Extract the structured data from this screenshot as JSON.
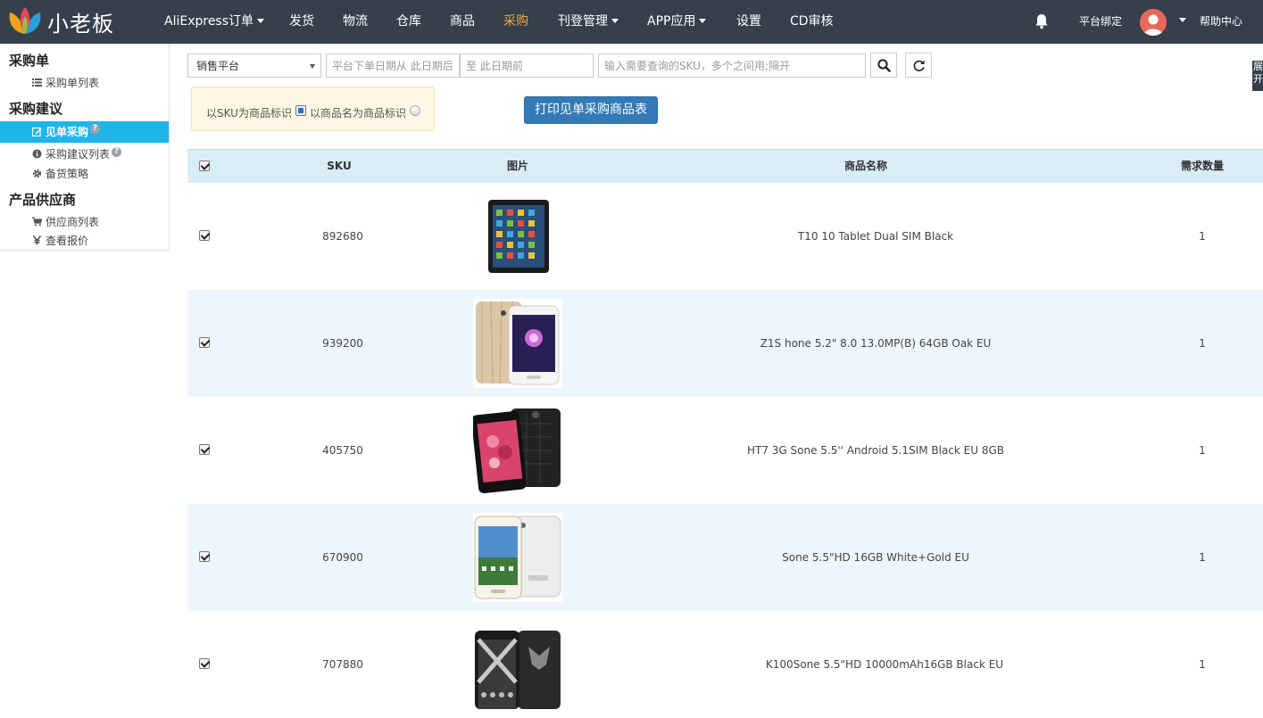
{
  "brand": {
    "name": "小老板"
  },
  "nav": {
    "items": [
      {
        "label": "AliExpress订单",
        "dropdown": true
      },
      {
        "label": "发货",
        "dropdown": false
      },
      {
        "label": "物流",
        "dropdown": false
      },
      {
        "label": "仓库",
        "dropdown": false
      },
      {
        "label": "商品",
        "dropdown": false
      },
      {
        "label": "采购",
        "dropdown": false,
        "active": true
      },
      {
        "label": "刊登管理",
        "dropdown": true
      },
      {
        "label": "APP应用",
        "dropdown": true
      },
      {
        "label": "设置",
        "dropdown": false
      },
      {
        "label": "CD审核",
        "dropdown": false
      }
    ],
    "platform_bind": "平台绑定",
    "help_center": "帮助中心"
  },
  "sidebar": {
    "sections": [
      {
        "title": "采购单",
        "items": [
          {
            "label": "采购单列表",
            "icon": "list-icon"
          }
        ]
      },
      {
        "title": "采购建议",
        "items": [
          {
            "label": "见单采购",
            "icon": "edit-icon",
            "active": true,
            "help": "?"
          },
          {
            "label": "采购建议列表",
            "icon": "info-circle-icon",
            "help": "?"
          },
          {
            "label": "备货策略",
            "icon": "gear-icon"
          }
        ]
      },
      {
        "title": "产品供应商",
        "items": [
          {
            "label": "供应商列表",
            "icon": "cart-icon"
          },
          {
            "label": "查看报价",
            "icon": "yen-icon"
          }
        ]
      }
    ]
  },
  "filters": {
    "platform_select": "销售平台",
    "date_from_placeholder": "平台下单日期从 此日期后",
    "date_to_placeholder": "至 此日期前",
    "sku_placeholder": "输入需要查询的SKU，多个之间用;隔开"
  },
  "options": {
    "by_sku": "以SKU为商品标识",
    "by_name": "以商品名为商品标识"
  },
  "print_button": "打印见单采购商品表",
  "table": {
    "headers": {
      "sku": "SKU",
      "image": "图片",
      "name": "商品名称",
      "qty": "需求数量"
    },
    "rows": [
      {
        "sku": "892680",
        "name": "T10 10 Tablet Dual SIM Black",
        "qty": "1",
        "image": "tablet-product-image"
      },
      {
        "sku": "939200",
        "name": "Z1S  hone 5.2\" 8.0 13.0MP(B) 64GB Oak EU",
        "qty": "1",
        "image": "oak-phone-product-image"
      },
      {
        "sku": "405750",
        "name": "HT7 3G Sone 5.5'' Android 5.1SIM Black EU 8GB",
        "qty": "1",
        "image": "black-phone-product-image"
      },
      {
        "sku": "670900",
        "name": "Sone 5.5\"HD 16GB White+Gold EU",
        "qty": "1",
        "image": "white-phone-product-image"
      },
      {
        "sku": "707880",
        "name": "K100Sone 5.5\"HD 10000mAh16GB Black EU",
        "qty": "1",
        "image": "rugged-phone-product-image"
      }
    ]
  },
  "edge_tab": "展开"
}
